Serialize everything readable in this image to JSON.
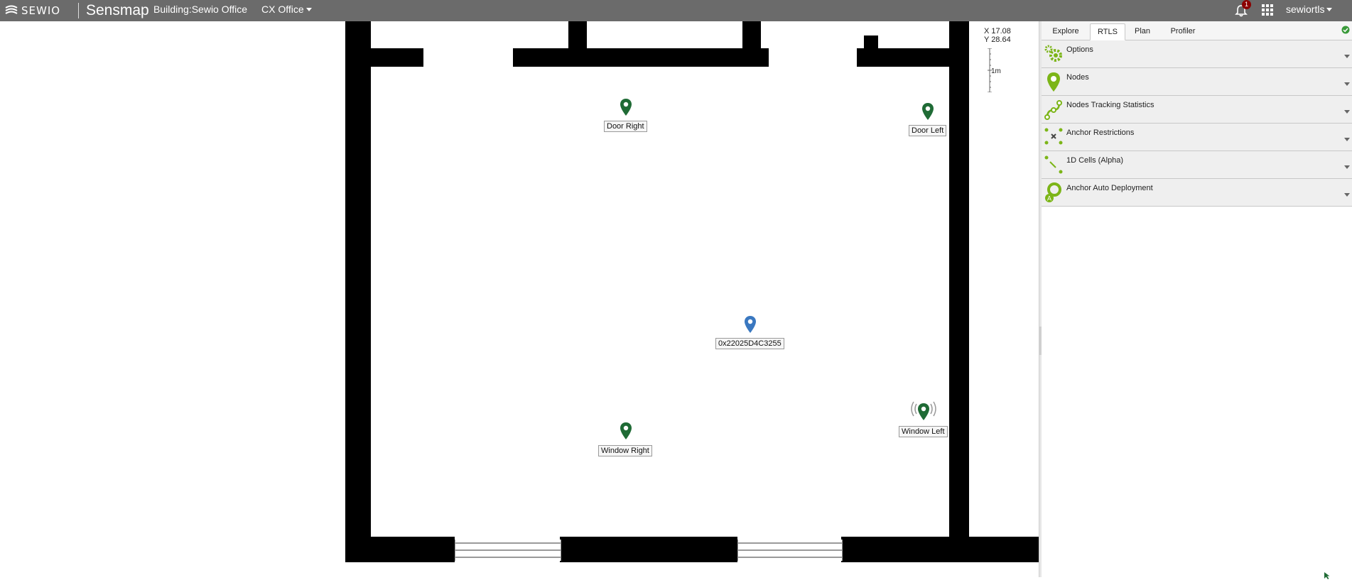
{
  "header": {
    "logo_text": "SEWIO",
    "brand": "Sensmap",
    "building": "Building:Sewio Office",
    "floor": "CX Office",
    "notification_count": "1",
    "username": "sewiortls"
  },
  "map": {
    "coords_x": "X 17.08",
    "coords_y": "Y 28.64",
    "scale_label": "1m",
    "anchors": [
      {
        "label": "Door Right"
      },
      {
        "label": "Door Left"
      },
      {
        "label": "Window Right"
      },
      {
        "label": "Window Left"
      }
    ],
    "tag": {
      "label": "0x22025D4C3255"
    },
    "colors": {
      "anchor": "#1f6b35",
      "tag": "#3a78c0",
      "wall": "#000000"
    }
  },
  "panel": {
    "tabs": [
      {
        "label": "Explore"
      },
      {
        "label": "RTLS",
        "active": true
      },
      {
        "label": "Plan"
      },
      {
        "label": "Profiler"
      }
    ],
    "sections": [
      {
        "title": "Options",
        "icon": "gears-icon"
      },
      {
        "title": "Nodes",
        "icon": "pin-icon"
      },
      {
        "title": "Nodes Tracking Statistics",
        "icon": "path-icon"
      },
      {
        "title": "Anchor Restrictions",
        "icon": "anchor-restrictions-icon"
      },
      {
        "title": "1D Cells (Alpha)",
        "icon": "cells-icon"
      },
      {
        "title": "Anchor Auto Deployment",
        "icon": "auto-deploy-icon"
      }
    ],
    "accent": "#7cb518"
  }
}
